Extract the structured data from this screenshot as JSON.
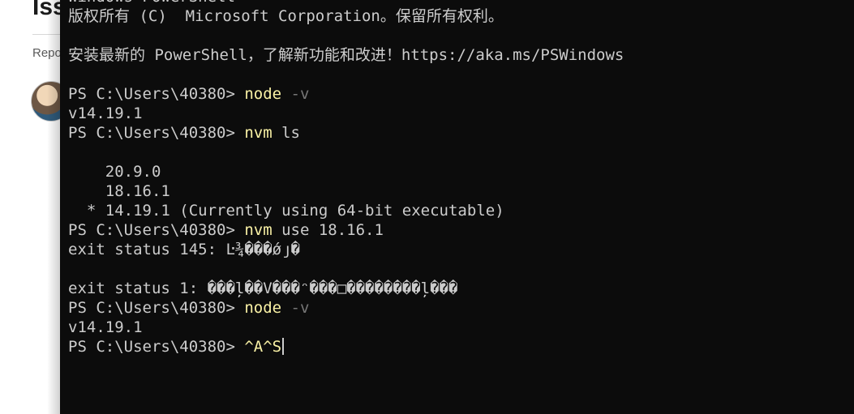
{
  "background_page": {
    "title": "Iss",
    "subtext": "Repo"
  },
  "terminal": {
    "lines": [
      {
        "kind": "text",
        "text": "Windows PowerShell"
      },
      {
        "kind": "text",
        "text": "版权所有 (C)  Microsoft Corporation。保留所有权利。"
      },
      {
        "kind": "blank",
        "text": ""
      },
      {
        "kind": "text",
        "text": "安装最新的 PowerShell，了解新功能和改进！https://aka.ms/PSWindows"
      },
      {
        "kind": "blank",
        "text": ""
      },
      {
        "kind": "command",
        "prompt": "PS C:\\Users\\40380> ",
        "cmd": "node",
        "args": "",
        "flag": " -v"
      },
      {
        "kind": "text",
        "text": "v14.19.1"
      },
      {
        "kind": "command",
        "prompt": "PS C:\\Users\\40380> ",
        "cmd": "nvm",
        "args": " ls",
        "flag": ""
      },
      {
        "kind": "blank",
        "text": ""
      },
      {
        "kind": "text",
        "text": "    20.9.0"
      },
      {
        "kind": "text",
        "text": "    18.16.1"
      },
      {
        "kind": "text",
        "text": "  * 14.19.1 (Currently using 64-bit executable)"
      },
      {
        "kind": "command",
        "prompt": "PS C:\\Users\\40380> ",
        "cmd": "nvm",
        "args": " use 18.16.1",
        "flag": ""
      },
      {
        "kind": "text",
        "text": "exit status 145: Ŀ¾���ǿյ�"
      },
      {
        "kind": "blank",
        "text": ""
      },
      {
        "kind": "text",
        "text": "exit status 1: ���ļ��V���ᵔ���□��������ļ���"
      },
      {
        "kind": "command",
        "prompt": "PS C:\\Users\\40380> ",
        "cmd": "node",
        "args": "",
        "flag": " -v"
      },
      {
        "kind": "text",
        "text": "v14.19.1"
      },
      {
        "kind": "current",
        "prompt": "PS C:\\Users\\40380> ",
        "cmd": "^A^S",
        "args": "",
        "flag": ""
      }
    ],
    "colors": {
      "background": "#0c0c0c",
      "foreground": "#cccccc",
      "command": "#f9f1a5",
      "parameter": "#767676"
    }
  }
}
